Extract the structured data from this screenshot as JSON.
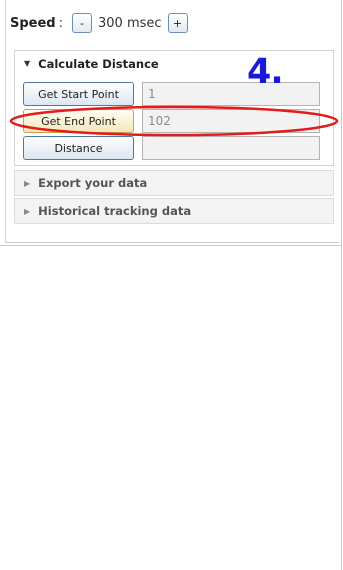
{
  "speed": {
    "label": "Speed",
    "colon": ":",
    "decrease_label": "-",
    "value": "300 msec",
    "increase_label": "+"
  },
  "sections": {
    "calculate": {
      "title": "Calculate Distance",
      "start_button": "Get Start Point",
      "start_value": "1",
      "end_button": "Get End Point",
      "end_value": "102",
      "distance_button": "Distance",
      "distance_value": ""
    },
    "export": {
      "title": "Export your data"
    },
    "history": {
      "title": "Historical tracking data"
    }
  },
  "annotation": {
    "step_number": "4.",
    "ring_color": "#e21b1b",
    "step_color": "#1a1ad6"
  }
}
